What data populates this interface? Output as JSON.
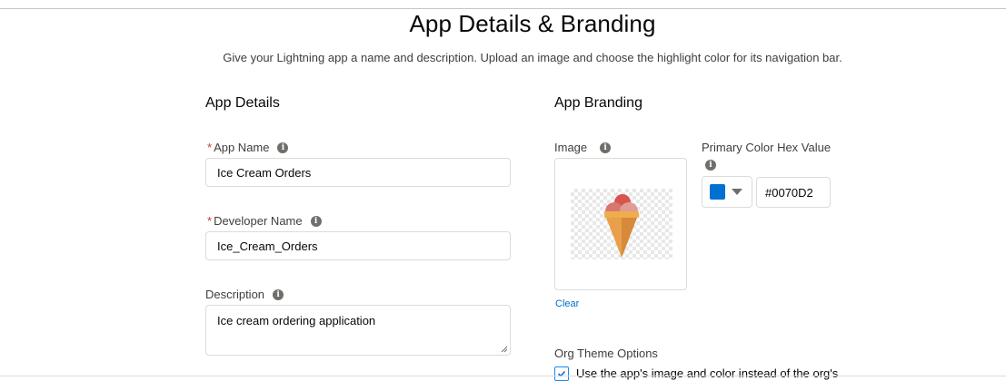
{
  "header": {
    "title": "App Details & Branding",
    "subtitle": "Give your Lightning app a name and description. Upload an image and choose the highlight color for its navigation bar."
  },
  "app_details": {
    "heading": "App Details",
    "app_name": {
      "label": "App Name",
      "required": "*",
      "value": "Ice Cream Orders"
    },
    "developer_name": {
      "label": "Developer Name",
      "required": "*",
      "value": "Ice_Cream_Orders"
    },
    "description": {
      "label": "Description",
      "value": "Ice cream ordering application"
    }
  },
  "app_branding": {
    "heading": "App Branding",
    "image": {
      "label": "Image",
      "icon": "ice-cream-cone-icon",
      "clear_label": "Clear"
    },
    "primary_color": {
      "label": "Primary Color Hex Value",
      "value": "#0070D2",
      "swatch_color": "#0070d2"
    },
    "org_theme": {
      "label": "Org Theme Options",
      "checkbox_label": "Use the app's image and color instead of the org's",
      "checked": true
    }
  },
  "icons": {
    "info": "info-icon",
    "check": "check-icon"
  }
}
